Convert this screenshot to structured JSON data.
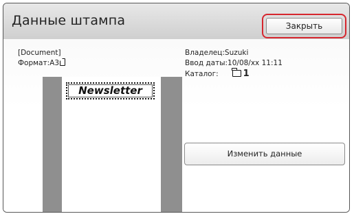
{
  "window": {
    "title": "Данные штампа"
  },
  "header": {
    "close_label": "Закрыть"
  },
  "details": {
    "document_name": "[Document]",
    "format_label": "Формат:А3",
    "owner_label": "Владелец:Suzuki",
    "date_label": "Ввод даты:10/08/xx 11:11",
    "catalog_label": "Каталог:",
    "catalog_value": "1"
  },
  "preview": {
    "stamp_text": "Newsletter"
  },
  "actions": {
    "change_label": "Изменить данные"
  },
  "colors": {
    "highlight": "#d6262e",
    "preview_bg": "#8f8f8f",
    "header_bg": "#d9d9d9"
  },
  "icons": {
    "paper": "paper-icon",
    "folder": "folder-icon"
  }
}
